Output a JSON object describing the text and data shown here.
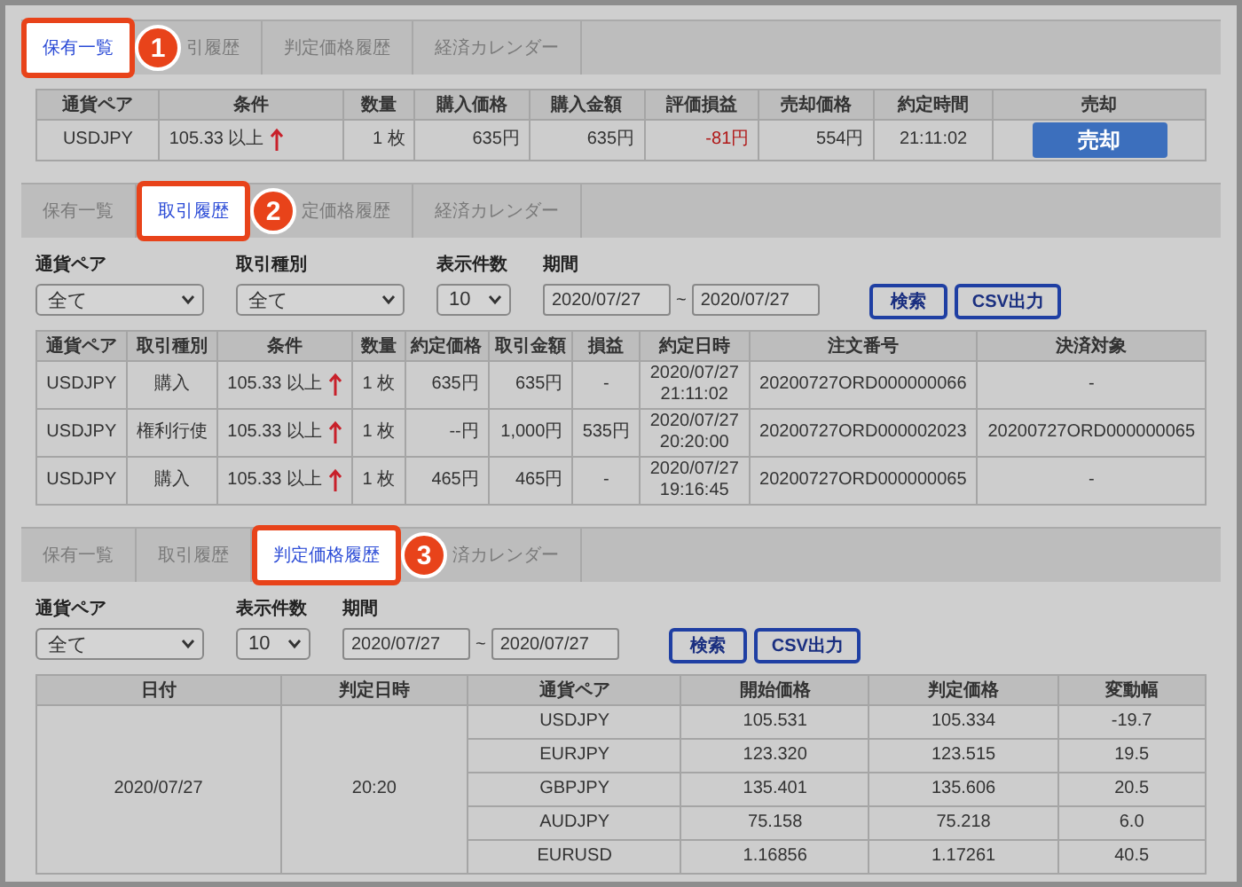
{
  "panels": [
    {
      "badge": "1",
      "tabs": [
        {
          "label": "保有一覧",
          "selected": true
        },
        {
          "label": "引履歴",
          "selected": false
        },
        {
          "label": "判定価格履歴",
          "selected": false
        },
        {
          "label": "経済カレンダー",
          "selected": false
        }
      ],
      "table": {
        "kind": "flat",
        "columns": [
          {
            "label": "通貨ペア",
            "kind": "text"
          },
          {
            "label": "条件",
            "kind": "cond"
          },
          {
            "label": "数量",
            "kind": "num"
          },
          {
            "label": "購入価格",
            "kind": "num"
          },
          {
            "label": "購入金額",
            "kind": "num"
          },
          {
            "label": "評価損益",
            "kind": "loss"
          },
          {
            "label": "売却価格",
            "kind": "num"
          },
          {
            "label": "約定時間",
            "kind": "text"
          },
          {
            "label": "売却",
            "kind": "action"
          }
        ],
        "rows": [
          [
            "USDJPY",
            "105.33 以上",
            "1 枚",
            "635円",
            "635円",
            "-81円",
            "554円",
            "21:11:02",
            "売却"
          ]
        ]
      }
    },
    {
      "badge": "2",
      "tabs": [
        {
          "label": "保有一覧",
          "selected": false
        },
        {
          "label": "取引履歴",
          "selected": true
        },
        {
          "label": "定価格履歴",
          "selected": false
        },
        {
          "label": "経済カレンダー",
          "selected": false
        }
      ],
      "filters": [
        {
          "kind": "select",
          "label": "通貨ペア",
          "value": "全て"
        },
        {
          "kind": "select",
          "label": "取引種別",
          "value": "全て"
        },
        {
          "kind": "count",
          "label": "表示件数",
          "value": "10"
        },
        {
          "kind": "range",
          "label": "期間",
          "from": "2020/07/27",
          "separator": "~",
          "to": "2020/07/27"
        }
      ],
      "buttons": [
        "検索",
        "CSV出力"
      ],
      "table": {
        "kind": "flat",
        "columns": [
          {
            "label": "通貨ペア",
            "kind": "text"
          },
          {
            "label": "取引種別",
            "kind": "text"
          },
          {
            "label": "条件",
            "kind": "cond"
          },
          {
            "label": "数量",
            "kind": "num"
          },
          {
            "label": "約定価格",
            "kind": "num"
          },
          {
            "label": "取引金額",
            "kind": "num"
          },
          {
            "label": "損益",
            "kind": "text"
          },
          {
            "label": "約定日時",
            "kind": "text"
          },
          {
            "label": "注文番号",
            "kind": "text"
          },
          {
            "label": "決済対象",
            "kind": "text"
          }
        ],
        "rows": [
          [
            "USDJPY",
            "購入",
            "105.33 以上",
            "1 枚",
            "635円",
            "635円",
            "-",
            "2020/07/27\n21:11:02",
            "20200727ORD000000066",
            "-"
          ],
          [
            "USDJPY",
            "権利行使",
            "105.33 以上",
            "1 枚",
            "--円",
            "1,000円",
            "535円",
            "2020/07/27\n20:20:00",
            "20200727ORD000002023",
            "20200727ORD000000065"
          ],
          [
            "USDJPY",
            "購入",
            "105.33 以上",
            "1 枚",
            "465円",
            "465円",
            "-",
            "2020/07/27\n19:16:45",
            "20200727ORD000000065",
            "-"
          ]
        ]
      }
    },
    {
      "badge": "3",
      "tabs": [
        {
          "label": "保有一覧",
          "selected": false
        },
        {
          "label": "取引履歴",
          "selected": false
        },
        {
          "label": "判定価格履歴",
          "selected": true
        },
        {
          "label": "済カレンダー",
          "selected": false
        }
      ],
      "filters": [
        {
          "kind": "select",
          "label": "通貨ペア",
          "value": "全て"
        },
        {
          "kind": "count",
          "label": "表示件数",
          "value": "10"
        },
        {
          "kind": "range",
          "label": "期間",
          "from": "2020/07/27",
          "separator": "~",
          "to": "2020/07/27"
        }
      ],
      "buttons": [
        "検索",
        "CSV出力"
      ],
      "table": {
        "kind": "grouped",
        "columns": [
          {
            "label": "日付",
            "kind": "text"
          },
          {
            "label": "判定日時",
            "kind": "text"
          },
          {
            "label": "通貨ペア",
            "kind": "text"
          },
          {
            "label": "開始価格",
            "kind": "text"
          },
          {
            "label": "判定価格",
            "kind": "text"
          },
          {
            "label": "変動幅",
            "kind": "text"
          }
        ],
        "groups": [
          {
            "date": "2020/07/27",
            "time": "20:20",
            "rows": [
              [
                "USDJPY",
                "105.531",
                "105.334",
                "-19.7"
              ],
              [
                "EURJPY",
                "123.320",
                "123.515",
                "19.5"
              ],
              [
                "GBPJPY",
                "135.401",
                "135.606",
                "20.5"
              ],
              [
                "AUDJPY",
                "75.158",
                "75.218",
                "6.0"
              ],
              [
                "EURUSD",
                "1.16856",
                "1.17261",
                "40.5"
              ]
            ]
          }
        ]
      }
    }
  ]
}
